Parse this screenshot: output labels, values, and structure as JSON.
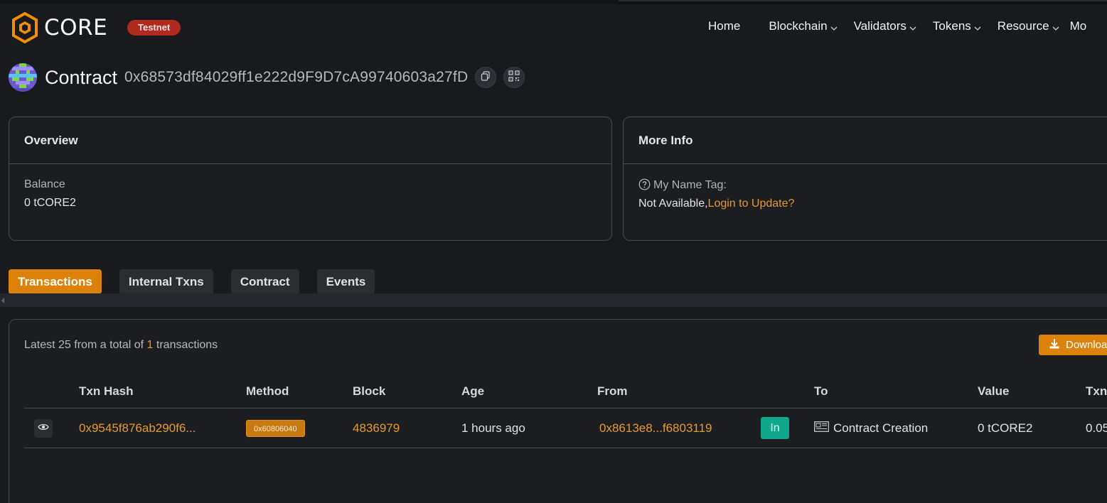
{
  "header": {
    "logo_text": "CORE",
    "network_badge": "Testnet",
    "nav": [
      {
        "label": "Home",
        "has_dropdown": false
      },
      {
        "label": "Blockchain",
        "has_dropdown": true
      },
      {
        "label": "Validators",
        "has_dropdown": true
      },
      {
        "label": "Tokens",
        "has_dropdown": true
      },
      {
        "label": "Resource",
        "has_dropdown": true
      },
      {
        "label": "Mo",
        "has_dropdown": false
      }
    ]
  },
  "page": {
    "title_label": "Contract",
    "address": "0x68573df84029ff1e222d9F9D7cA99740603a27fD",
    "copy_icon": "copy-icon",
    "qr_icon": "qr-code-icon"
  },
  "overview": {
    "title": "Overview",
    "balance_label": "Balance",
    "balance_value": "0 tCORE2"
  },
  "more_info": {
    "title": "More Info",
    "name_tag_label": "My Name Tag:",
    "name_tag_value": "Not Available,",
    "login_link": "Login to Update?"
  },
  "tabs": [
    {
      "label": "Transactions",
      "active": true
    },
    {
      "label": "Internal Txns",
      "active": false
    },
    {
      "label": "Contract",
      "active": false
    },
    {
      "label": "Events",
      "active": false
    }
  ],
  "transactions": {
    "summary_prefix": "Latest 25 from a total of ",
    "summary_count": "1",
    "summary_suffix": " transactions",
    "download_label": "Downloa",
    "columns": [
      "Txn Hash",
      "Method",
      "Block",
      "Age",
      "From",
      "To",
      "Value",
      "Txn"
    ],
    "rows": [
      {
        "txn_hash": "0x9545f876ab290f6...",
        "method": "0x60806040",
        "block": "4836979",
        "age": "1 hours ago",
        "from": "0x8613e8...f6803119",
        "direction": "In",
        "to": "Contract Creation",
        "value": "0 tCORE2",
        "fee": "0.05"
      }
    ]
  },
  "colors": {
    "accent": "#dc820b",
    "link": "#e59a2f",
    "testnet_badge": "#b02a20",
    "in_badge": "#0fa88a",
    "background": "#181a1e"
  }
}
